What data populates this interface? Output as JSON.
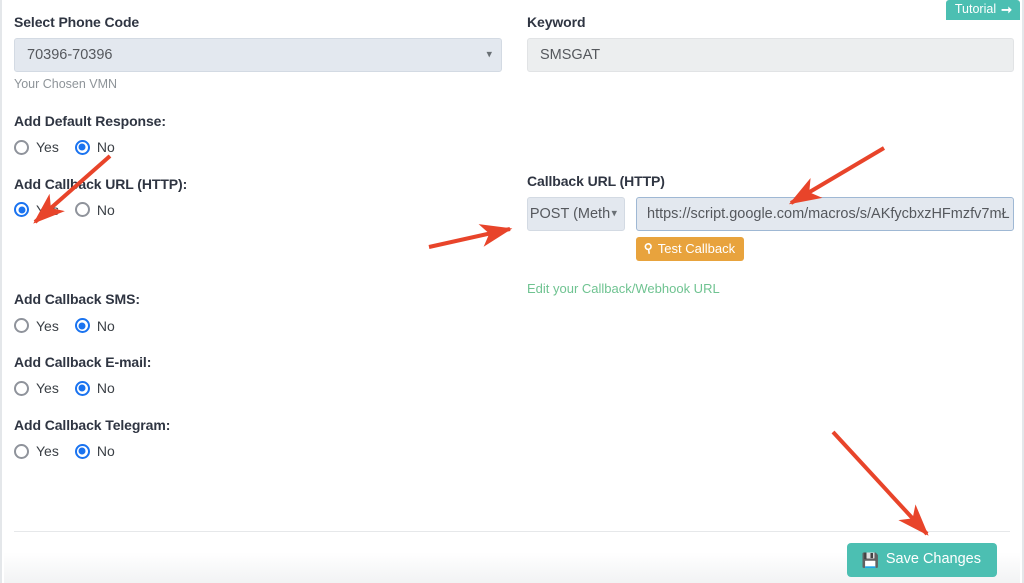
{
  "header": {
    "tutorial_label": "Tutorial",
    "tutorial_icon": "arrow-right-icon"
  },
  "left_column": {
    "phone_code": {
      "label": "Select Phone Code",
      "selected_value": "70396-70396",
      "help_text": "Your Chosen VMN",
      "icon": "chevron-down-icon"
    },
    "default_response": {
      "label": "Add Default Response:",
      "options": [
        "Yes",
        "No"
      ],
      "selected": "No"
    },
    "callback_url_http": {
      "label": "Add Callback URL (HTTP):",
      "options": [
        "Yes",
        "No"
      ],
      "selected": "Yes"
    },
    "callback_sms": {
      "label": "Add Callback SMS:",
      "options": [
        "Yes",
        "No"
      ],
      "selected": "No"
    },
    "callback_email": {
      "label": "Add Callback E-mail:",
      "options": [
        "Yes",
        "No"
      ],
      "selected": "No"
    },
    "callback_telegram": {
      "label": "Add Callback Telegram:",
      "options": [
        "Yes",
        "No"
      ],
      "selected": "No"
    }
  },
  "right_column": {
    "keyword": {
      "label": "Keyword",
      "value": "SMSGAT"
    },
    "callback": {
      "label": "Callback URL (HTTP)",
      "method_value": "POST (Meth",
      "method_icon": "chevron-down-icon",
      "url_value": "https://script.google.com/macros/s/AKfycbxzHFmzfv7mŁ",
      "test_button_label": "Test Callback",
      "test_button_icon": "search-icon",
      "edit_link_label": "Edit your Callback/Webhook URL"
    }
  },
  "footer": {
    "save_label": "Save Changes",
    "save_icon": "floppy-disk-icon"
  },
  "colors": {
    "teal": "#4cbfb2",
    "orange": "#e8a33d",
    "green_link": "#6fc391",
    "radio_blue": "#1a73f0",
    "annotation_red": "#e8442a",
    "select_bg": "#e3e8ef",
    "input_bg": "#eceeef"
  },
  "annotations": [
    {
      "name": "arrow-to-callback-yes-radio",
      "points_to": "Add Callback URL (HTTP): Yes radio"
    },
    {
      "name": "arrow-to-method-select",
      "points_to": "POST (Method) select"
    },
    {
      "name": "arrow-to-url-input",
      "points_to": "Callback URL text input"
    },
    {
      "name": "arrow-to-save-button",
      "points_to": "Save Changes button"
    }
  ]
}
